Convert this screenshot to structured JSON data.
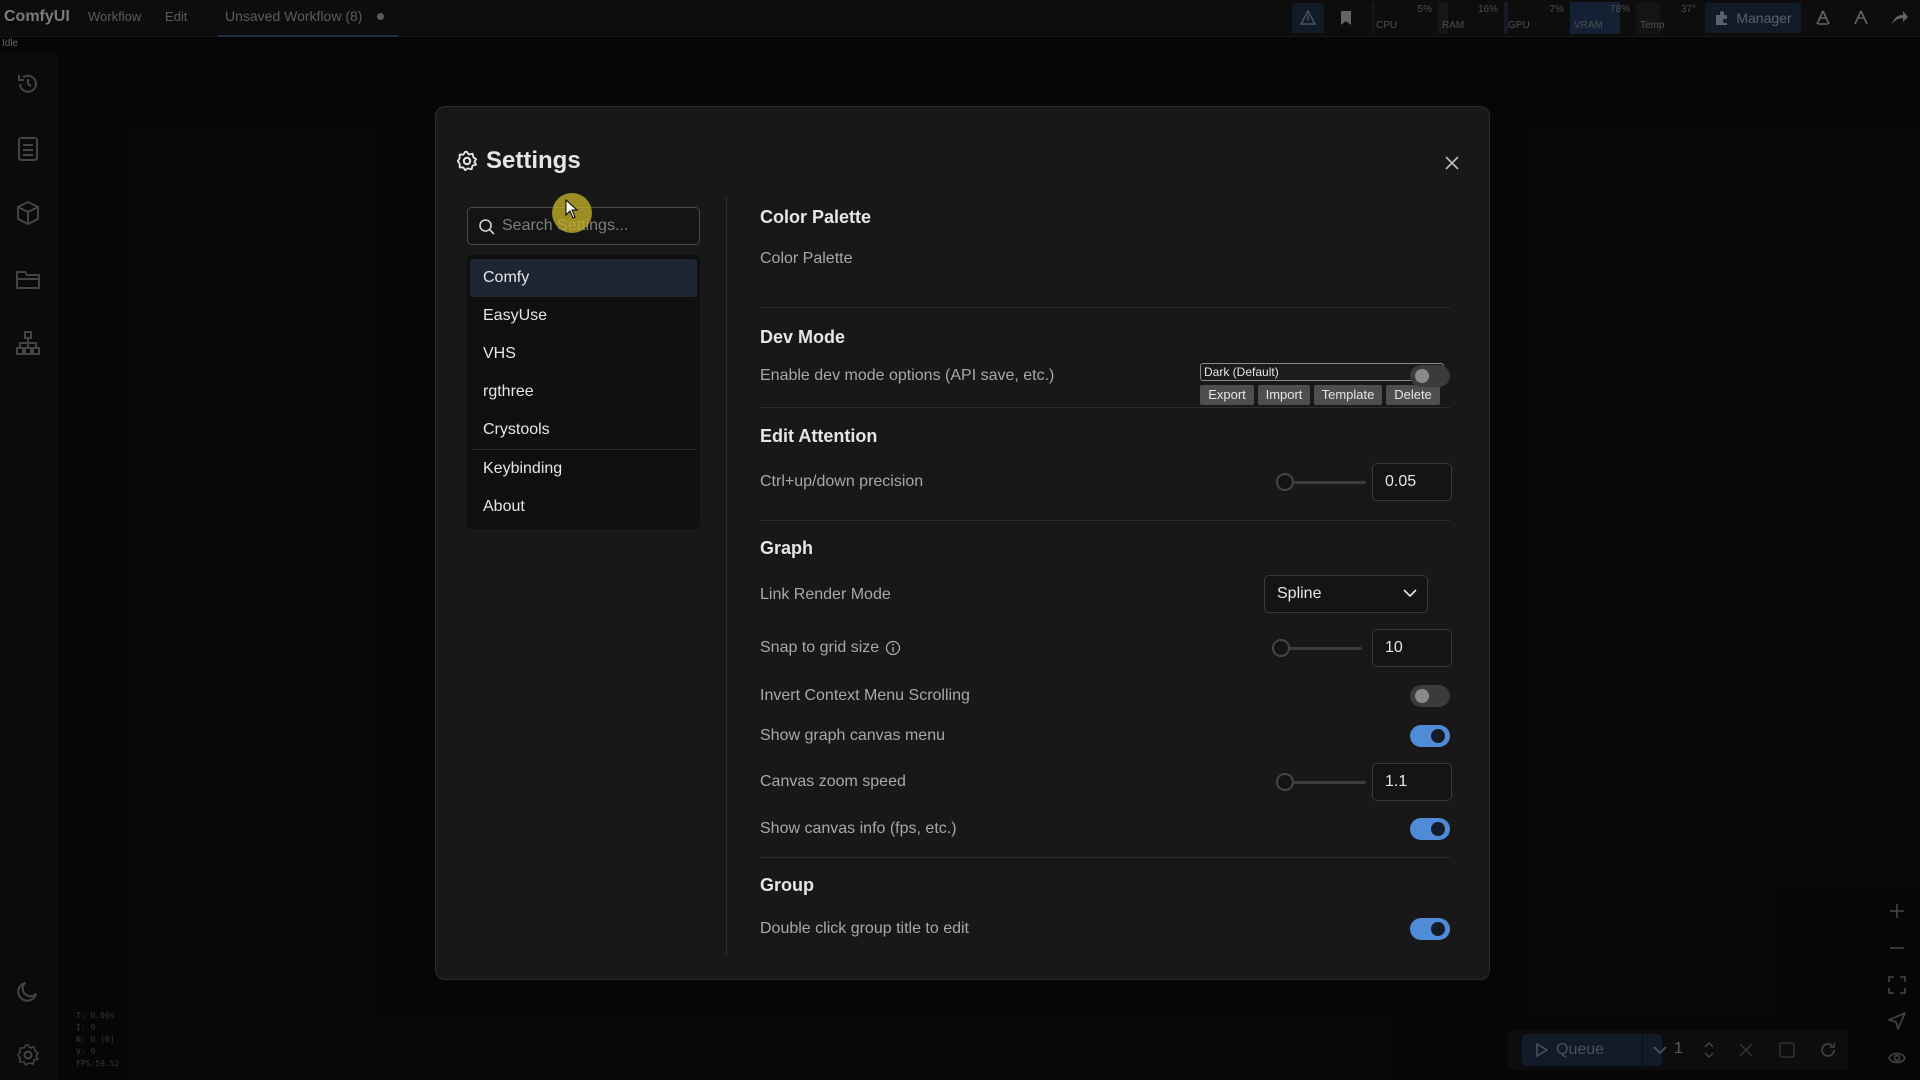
{
  "topbar": {
    "brand": "ComfyUI",
    "menu_workflow": "Workflow",
    "menu_edit": "Edit",
    "tab_title": "Unsaved Workflow (8)",
    "status": "Idle",
    "monitors": [
      {
        "label": "CPU",
        "value": "5%",
        "fill_percent": 5
      },
      {
        "label": "RAM",
        "value": "16%",
        "fill_percent": 16
      },
      {
        "label": "GPU",
        "value": "7%",
        "fill_percent": 7
      },
      {
        "label": "VRAM",
        "value": "78%",
        "fill_percent": 78
      },
      {
        "label": "Temp",
        "value": "37°",
        "fill_percent": 37
      }
    ],
    "manager_label": "Manager"
  },
  "canvas_info": [
    "T: 0.00s",
    "I: 0",
    "N: 0 [0]",
    "V: 0",
    "FPS:59.52"
  ],
  "queue": {
    "label": "Queue",
    "count": "1"
  },
  "settings": {
    "title": "Settings",
    "search_placeholder": "Search Settings...",
    "categories": [
      "Comfy",
      "EasyUse",
      "VHS",
      "rgthree",
      "Crystools",
      "Keybinding",
      "About"
    ],
    "selected_category": "Comfy",
    "sections": {
      "color_palette": {
        "title": "Color Palette",
        "label": "Color Palette",
        "selected": "Dark (Default)",
        "buttons": [
          "Export",
          "Import",
          "Template",
          "Delete"
        ]
      },
      "dev_mode": {
        "title": "Dev Mode",
        "enable_label": "Enable dev mode options (API save, etc.)",
        "enabled": false
      },
      "edit_attention": {
        "title": "Edit Attention",
        "precision_label": "Ctrl+up/down precision",
        "precision_value": "0.05"
      },
      "graph": {
        "title": "Graph",
        "link_render_label": "Link Render Mode",
        "link_render_value": "Spline",
        "snap_label": "Snap to grid size",
        "snap_value": "10",
        "invert_label": "Invert Context Menu Scrolling",
        "invert_enabled": false,
        "canvas_menu_label": "Show graph canvas menu",
        "canvas_menu_enabled": true,
        "zoom_label": "Canvas zoom speed",
        "zoom_value": "1.1",
        "canvas_info_label": "Show canvas info (fps, etc.)",
        "canvas_info_enabled": true
      },
      "group": {
        "title": "Group",
        "dblclick_label": "Double click group title to edit",
        "dblclick_enabled": true
      }
    }
  },
  "colors": {
    "accent": "#4f8bd6",
    "selected_bg": "#1d2533",
    "vram_fill": "#2a4a72",
    "manager_bg": "#1a2a3d"
  }
}
